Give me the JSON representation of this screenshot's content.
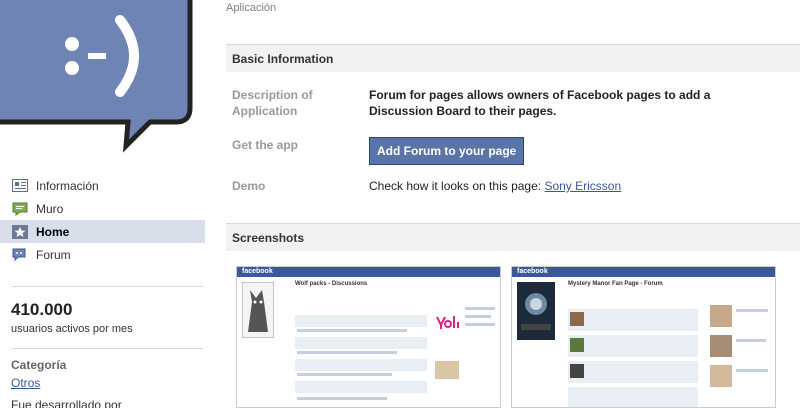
{
  "app_label": "Aplicación",
  "nav": {
    "items": [
      {
        "label": "Información",
        "icon": "info-icon"
      },
      {
        "label": "Muro",
        "icon": "wall-icon"
      },
      {
        "label": "Home",
        "icon": "star-icon",
        "active": true
      },
      {
        "label": "Forum",
        "icon": "forum-icon"
      }
    ]
  },
  "stats": {
    "count": "410.000",
    "label": "usuarios activos por mes"
  },
  "category": {
    "heading": "Categoría",
    "value": "Otros"
  },
  "cut_text": "Fue desarrollado por",
  "basic": {
    "heading": "Basic Information",
    "desc_label": "Description of Application",
    "desc_value": "Forum for pages allows owners of Facebook pages to add a Discussion Board to their pages.",
    "get_label": "Get the app",
    "get_button": "Add Forum to your page",
    "demo_label": "Demo",
    "demo_text": "Check how it looks on this page:",
    "demo_link": "Sony Ericsson"
  },
  "screenshots": {
    "heading": "Screenshots",
    "thumb1_title": "Wolf packs - Discussions",
    "thumb2_title": "Mystery Manor Fan Page - Forum",
    "brand": "facebook"
  },
  "colors": {
    "fb_blue": "#3b5998",
    "button": "#5b74a8",
    "logo": "#6d84b4"
  }
}
